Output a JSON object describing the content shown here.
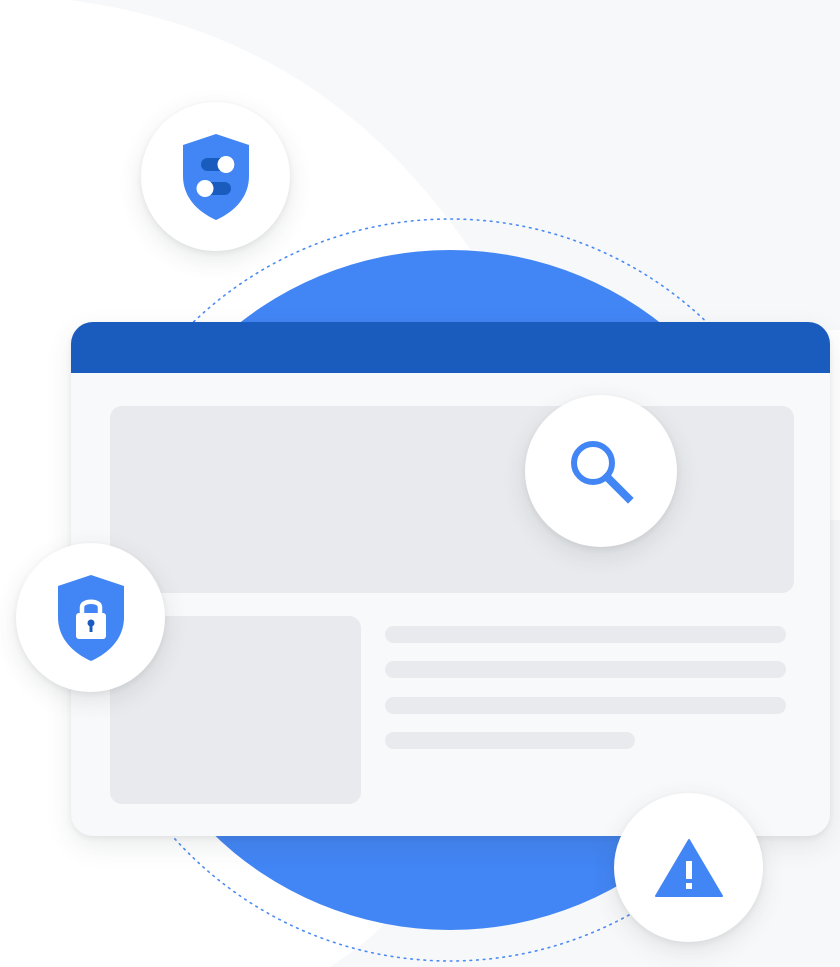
{
  "illustration": {
    "colors": {
      "page_background": "#ffffff",
      "soft_panel": "#f7f8fa",
      "primary_blue": "#4285f4",
      "titlebar_blue": "#1a5bbe",
      "dotted_ring": "#4a8af4",
      "window_body": "#f8f9fa",
      "placeholder_gray": "#e8eaed",
      "badge_white": "#ffffff"
    },
    "icons": [
      "settings-shield-icon",
      "search-icon",
      "lock-shield-icon",
      "warning-icon"
    ]
  }
}
